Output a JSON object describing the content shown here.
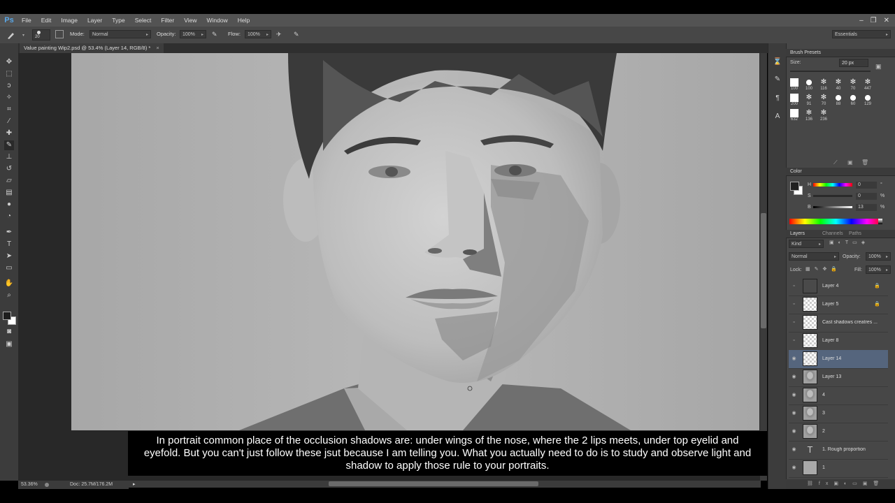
{
  "app": {
    "logo": "Ps"
  },
  "menu": [
    "File",
    "Edit",
    "Image",
    "Layer",
    "Type",
    "Select",
    "Filter",
    "View",
    "Window",
    "Help"
  ],
  "window_controls": [
    "–",
    "❐",
    "✕"
  ],
  "options": {
    "brush_size": "20",
    "mode_label": "Mode:",
    "mode_value": "Normal",
    "opacity_label": "Opacity:",
    "opacity_value": "100%",
    "flow_label": "Flow:",
    "flow_value": "100%",
    "workspace": "Essentials"
  },
  "document": {
    "tab_title": "Value painting Wip2.psd @ 53.4% (Layer 14, RGB/8) *",
    "close": "×"
  },
  "subtitle": "In portrait common place of the occlusion shadows are: under wings of the nose, where the 2 lips meets, under top eyelid and eyefold. But you can't just follow these jsut because I am telling you. What you actually need to do is to study and observe light and shadow to apply those rule to your portraits.",
  "status": {
    "zoom": "53.36%",
    "doc": "Doc: 25.7M/176.2M"
  },
  "brush_presets": {
    "title": "Brush Presets",
    "size_label": "Size:",
    "size_value": "20 px",
    "sizes_row1": [
      "100",
      "100",
      "116",
      "40",
      "70",
      "447"
    ],
    "sizes_row2": [
      "200",
      "91",
      "70",
      "88",
      "60",
      "129"
    ],
    "sizes_row3": [
      "632",
      "136",
      "236"
    ]
  },
  "color": {
    "title": "Color",
    "h_label": "H",
    "h_value": "0",
    "h_unit": "°",
    "s_label": "S",
    "s_value": "0",
    "s_unit": "%",
    "b_label": "B",
    "b_value": "13",
    "b_unit": "%",
    "foreground": "#212121"
  },
  "layers_panel": {
    "tabs": [
      "Layers",
      "Channels",
      "Paths"
    ],
    "kind": "Kind",
    "blend": "Normal",
    "opacity_label": "Opacity:",
    "opacity_value": "100%",
    "lock_label": "Lock:",
    "fill_label": "Fill:",
    "fill_value": "100%",
    "layers": [
      {
        "name": "Layer 4",
        "visible": false,
        "locked": true,
        "thumb": "dark"
      },
      {
        "name": "Layer 5",
        "visible": false,
        "locked": true,
        "thumb": "checker"
      },
      {
        "name": "Cast shadows creatres ...",
        "visible": false,
        "locked": false,
        "thumb": "checker"
      },
      {
        "name": "Layer 8",
        "visible": false,
        "locked": false,
        "thumb": "checker"
      },
      {
        "name": "Layer 14",
        "visible": true,
        "locked": false,
        "thumb": "checker",
        "selected": true
      },
      {
        "name": "Layer 13",
        "visible": true,
        "locked": false,
        "thumb": "portrait"
      },
      {
        "name": "4",
        "visible": true,
        "locked": false,
        "thumb": "portrait"
      },
      {
        "name": "3",
        "visible": true,
        "locked": false,
        "thumb": "portrait"
      },
      {
        "name": "2",
        "visible": true,
        "locked": false,
        "thumb": "portrait"
      },
      {
        "name": "1. Rough proportion",
        "visible": true,
        "locked": false,
        "thumb": "text"
      },
      {
        "name": "1",
        "visible": true,
        "locked": false,
        "thumb": "gray"
      }
    ]
  }
}
